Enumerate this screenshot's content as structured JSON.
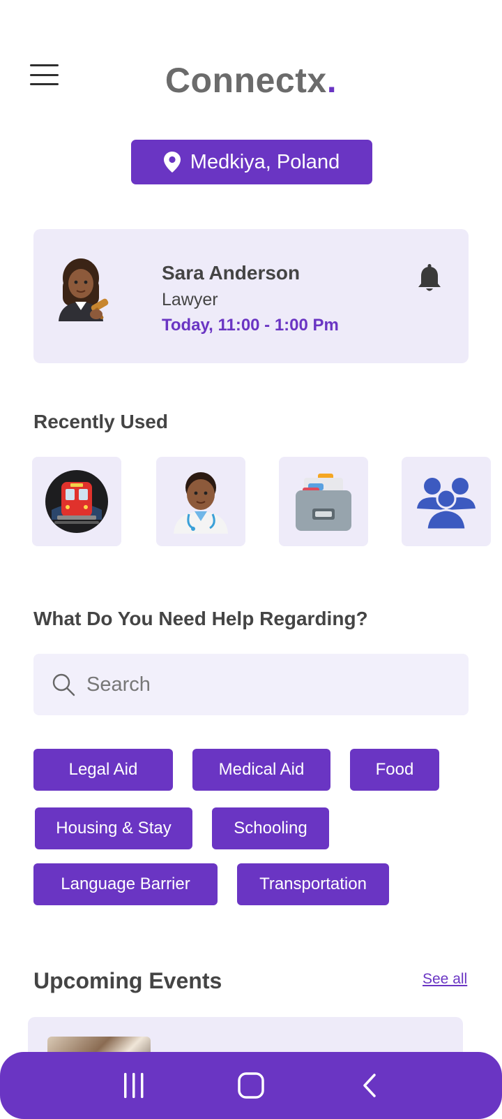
{
  "header": {
    "brand_text": "Connectx",
    "brand_dot": "."
  },
  "location": {
    "label": "Medkiya, Poland",
    "icon": "location-pin-icon"
  },
  "appointment": {
    "name": "Sara Anderson",
    "role": "Lawyer",
    "time": "Today, 11:00 - 1:00 Pm",
    "avatar_icon": "woman-judge-emoji",
    "bell_icon": "bell-icon"
  },
  "recently_used": {
    "title": "Recently Used",
    "items": [
      {
        "icon": "metro-train-icon"
      },
      {
        "icon": "doctor-icon"
      },
      {
        "icon": "card-file-box-icon"
      },
      {
        "icon": "community-group-icon"
      }
    ]
  },
  "help": {
    "title": "What Do You Need Help Regarding?",
    "search_placeholder": "Search",
    "chips": [
      "Legal Aid",
      "Medical Aid",
      "Food",
      "Housing & Stay",
      "Schooling",
      "Language Barrier",
      "Transportation"
    ]
  },
  "events": {
    "title": "Upcoming Events",
    "see_all": "See all"
  },
  "nav": {
    "recents_icon": "recent-apps-icon",
    "home_icon": "home-icon",
    "back_icon": "back-icon"
  },
  "colors": {
    "accent": "#6a35c3",
    "card_bg": "#eeebf9",
    "text_dark": "#444444"
  }
}
